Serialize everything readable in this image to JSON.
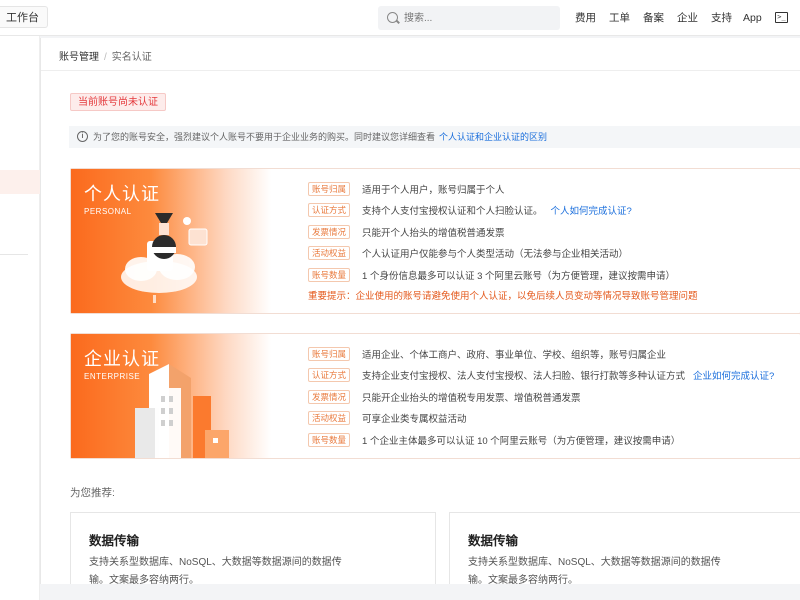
{
  "topbar": {
    "workbench_label": "工作台",
    "search_placeholder": "搜索...",
    "nav_items": [
      "费用",
      "工单",
      "备案",
      "企业",
      "支持",
      "App"
    ]
  },
  "breadcrumb": {
    "root": "账号管理",
    "separator": "/",
    "current": "实名认证"
  },
  "status": "当前账号尚未认证",
  "notice": {
    "text": "为了您的账号安全，强烈建议个人账号不要用于企业业务的购买。同时建议您详细查看",
    "link": "个人认证和企业认证的区别"
  },
  "personal": {
    "title": "个人认证",
    "subtitle": "PERSONAL",
    "rows": [
      {
        "tag": "账号归属",
        "text": "适用于个人用户，账号归属于个人",
        "link": ""
      },
      {
        "tag": "认证方式",
        "text": "支持个人支付宝授权认证和个人扫脸认证。",
        "link": "个人如何完成认证?"
      },
      {
        "tag": "发票情况",
        "text": "只能开个人抬头的增值税普通发票",
        "link": ""
      },
      {
        "tag": "活动权益",
        "text": "个人认证用户仅能参与个人类型活动（无法参与企业相关活动）",
        "link": ""
      },
      {
        "tag": "账号数量",
        "text": "1 个身份信息最多可以认证 3 个阿里云账号（为方便管理，建议按需申请）",
        "link": ""
      }
    ],
    "warning": "重要提示：企业使用的账号请避免使用个人认证，以免后续人员变动等情况导致账号管理问题"
  },
  "enterprise": {
    "title": "企业认证",
    "subtitle": "ENTERPRISE",
    "rows": [
      {
        "tag": "账号归属",
        "text": "适用企业、个体工商户、政府、事业单位、学校、组织等，账号归属企业",
        "link": ""
      },
      {
        "tag": "认证方式",
        "text": "支持企业支付宝授权、法人支付宝授权、法人扫脸、银行打款等多种认证方式",
        "link": "企业如何完成认证?"
      },
      {
        "tag": "发票情况",
        "text": "只能开企业抬头的增值税专用发票、增值税普通发票",
        "link": ""
      },
      {
        "tag": "活动权益",
        "text": "可享企业类专属权益活动",
        "link": ""
      },
      {
        "tag": "账号数量",
        "text": "1 个企业主体最多可以认证 10 个阿里云账号（为方便管理，建议按需申请）",
        "link": ""
      }
    ]
  },
  "recommend": {
    "label": "为您推荐:",
    "cards": [
      {
        "title": "数据传输",
        "desc": "支持关系型数据库、NoSQL、大数据等数据源间的数据传输。文案最多容纳两行。"
      },
      {
        "title": "数据传输",
        "desc": "支持关系型数据库、NoSQL、大数据等数据源间的数据传输。文案最多容纳两行。"
      }
    ]
  },
  "colors": {
    "accent": "#fb6a1d",
    "link": "#1a6edc",
    "danger": "#e4393c"
  }
}
